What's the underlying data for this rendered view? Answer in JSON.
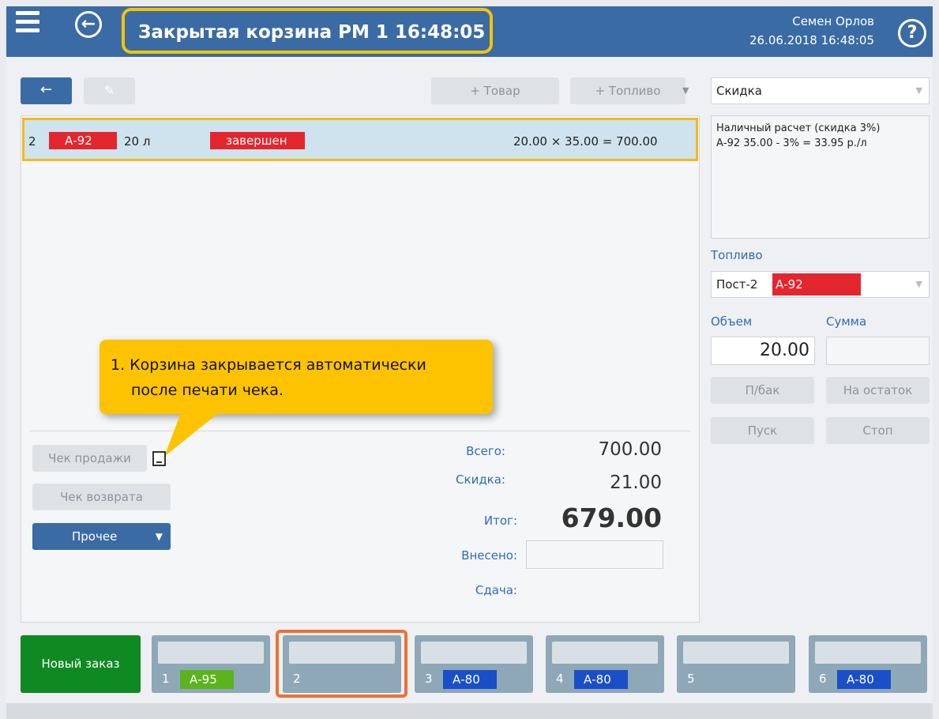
{
  "header": {
    "title": "Закрытая корзина  РМ 1  16:48:05",
    "user": "Семен Орлов",
    "datetime": "26.06.2018 16:48:05",
    "back_icon": "arrow-left-circle-icon",
    "help_icon": "question-circle-icon"
  },
  "toolbar": {
    "back_label": "←",
    "edit_label": "✎",
    "add_item_label": "+ Товар",
    "add_fuel_label": "+ Топливо",
    "discount_select": "Скидка"
  },
  "order_row": {
    "num": "2",
    "fuel": "А-92",
    "volume": "20 л",
    "status": "завершен",
    "calc": "20.00 × 35.00 =  700.00"
  },
  "callout": {
    "line1": "1. Корзина закрывается автоматически",
    "line2": "после печати чека."
  },
  "actions": {
    "sale_receipt": "Чек продажи",
    "return_receipt": "Чек возврата",
    "other": "Прочее"
  },
  "totals": {
    "total_label": "Всего:",
    "total_value": "700.00",
    "discount_label": "Скидка:",
    "discount_value": "21.00",
    "final_label": "Итог:",
    "final_value": "679.00",
    "paid_label": "Внесено:",
    "change_label": "Сдача:"
  },
  "right_panel": {
    "discount_info_line1": "Наличный расчет (скидка 3%)",
    "discount_info_line2": "А-92 35.00 - 3% = 33.95 р./л",
    "fuel_label": "Топливо",
    "pump": "Пост-2",
    "pump_fuel": "А-92",
    "volume_label": "Объем",
    "sum_label": "Сумма",
    "volume_value": "20.00",
    "full_tank": "П/бак",
    "remainder": "На остаток",
    "start": "Пуск",
    "stop": "Стоп"
  },
  "bottom": {
    "new_order": "Новый заказ",
    "tabs": [
      {
        "num": "1",
        "fuel": "А-95",
        "color": "#5bb41e"
      },
      {
        "num": "2",
        "fuel": "",
        "color": ""
      },
      {
        "num": "3",
        "fuel": "А-80",
        "color": "#1a4fc8"
      },
      {
        "num": "4",
        "fuel": "А-80",
        "color": "#1a4fc8"
      },
      {
        "num": "5",
        "fuel": "",
        "color": ""
      },
      {
        "num": "6",
        "fuel": "А-80",
        "color": "#1a4fc8"
      }
    ]
  },
  "colors": {
    "accent": "#3b6ba5",
    "highlight": "#f5c400",
    "active_tab_border": "#f07030",
    "new_order": "#0f8a22",
    "fuel_red": "#e3262e"
  }
}
